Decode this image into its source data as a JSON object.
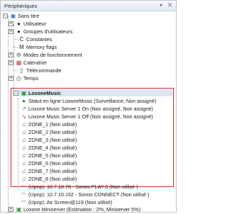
{
  "window": {
    "title": "Périphériques"
  },
  "tree": {
    "root": "Sans titre",
    "items": [
      {
        "label": "Utilisateur",
        "icon": "user-icon"
      },
      {
        "label": "Groupes d'utilisateurs",
        "icon": "users-icon"
      },
      {
        "label": "Constantes",
        "icon": "constant-icon"
      },
      {
        "label": "Memory flags",
        "icon": "memory-icon"
      },
      {
        "label": "Modes de fonctionnement",
        "icon": "gear-icon"
      },
      {
        "label": "Calendrier",
        "icon": "calendar-icon"
      },
      {
        "label": "Télécommande",
        "icon": "remote-icon"
      },
      {
        "label": "Temps",
        "icon": "clock-icon"
      }
    ],
    "group": {
      "label": "LoxoneMusic",
      "children": [
        {
          "label": "Statut en ligne LoxoneMusic (Surveillance, Non assigné)",
          "icon": "status-icon"
        },
        {
          "label": "Loxone Music Server 1 On (Non assigné, Non assigné)",
          "icon": "on-icon"
        },
        {
          "label": "Loxone Music Server 1 Off (Non assigné, Non assigné)",
          "icon": "off-icon"
        },
        {
          "label": "ZONE_1 (Non utilisé)",
          "icon": "music-note-icon"
        },
        {
          "label": "ZONE_2 (Non utilisé)",
          "icon": "music-note-icon"
        },
        {
          "label": "ZONE_3 (Non utilisé)",
          "icon": "music-note-icon"
        },
        {
          "label": "ZONE_4 (Non utilisé)",
          "icon": "music-note-icon"
        },
        {
          "label": "ZONE_5 (Non utilisé)",
          "icon": "music-note-icon"
        },
        {
          "label": "ZONE_6 (Non utilisé)",
          "icon": "music-note-icon"
        },
        {
          "label": "ZONE_7 (Non utilisé)",
          "icon": "music-note-icon"
        },
        {
          "label": "ZONE_8 (Non utilisé)",
          "icon": "music-note-icon"
        },
        {
          "label": "(Upnp): 10.7.10.78 - Sonos PLAY:3 (Non utilisé )",
          "icon": "wifi-icon"
        },
        {
          "label": "(Upnp): 10.7.10.152 - Sonos CONNECT (Non utilisé )",
          "icon": "wifi-icon"
        },
        {
          "label": "(Upnp): Air Screen@119 (Non utilisé)",
          "icon": "wifi-icon"
        }
      ]
    },
    "footer_item": {
      "label": "Loxone Miniserver (Estimation : 2%, Miniserver 5%)",
      "icon": "miniserver-icon"
    }
  },
  "colors": {
    "highlight_border": "#d9242b",
    "note": "#2e8b2e",
    "on": "#2a9d2a",
    "off": "#c0392b"
  }
}
